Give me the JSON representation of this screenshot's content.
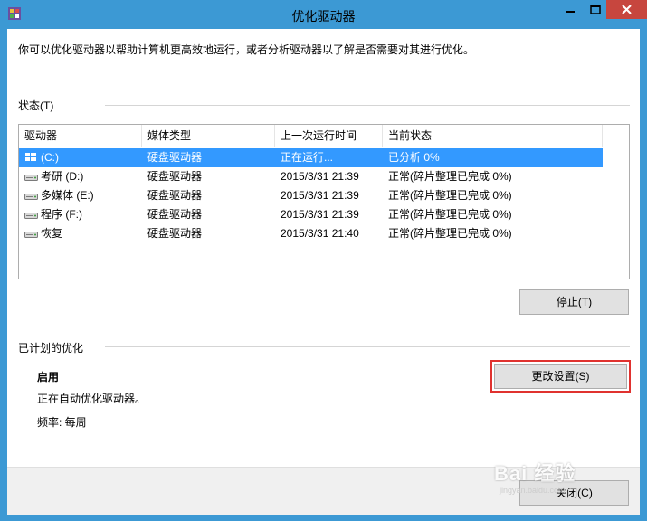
{
  "window": {
    "title": "优化驱动器",
    "accent_color": "#3c99d4",
    "close_color": "#c7463e"
  },
  "intro_text": "你可以优化驱动器以帮助计算机更高效地运行，或者分析驱动器以了解是否需要对其进行优化。",
  "status_section": {
    "label": "状态(T)"
  },
  "drive_table": {
    "columns": [
      "驱动器",
      "媒体类型",
      "上一次运行时间",
      "当前状态"
    ],
    "rows": [
      {
        "drive": "(C:)",
        "media": "硬盘驱动器",
        "last_run": "正在运行...",
        "status": "已分析 0%",
        "icon": "windows-drive-icon",
        "selected": true
      },
      {
        "drive": "考研 (D:)",
        "media": "硬盘驱动器",
        "last_run": "2015/3/31 21:39",
        "status": "正常(碎片整理已完成 0%)",
        "icon": "hard-drive-icon",
        "selected": false
      },
      {
        "drive": "多媒体 (E:)",
        "media": "硬盘驱动器",
        "last_run": "2015/3/31 21:39",
        "status": "正常(碎片整理已完成 0%)",
        "icon": "hard-drive-icon",
        "selected": false
      },
      {
        "drive": "程序 (F:)",
        "media": "硬盘驱动器",
        "last_run": "2015/3/31 21:39",
        "status": "正常(碎片整理已完成 0%)",
        "icon": "hard-drive-icon",
        "selected": false
      },
      {
        "drive": "恢复",
        "media": "硬盘驱动器",
        "last_run": "2015/3/31 21:40",
        "status": "正常(碎片整理已完成 0%)",
        "icon": "hard-drive-icon",
        "selected": false
      }
    ]
  },
  "buttons": {
    "stop": "停止(T)",
    "change_settings": "更改设置(S)",
    "close": "关闭(C)"
  },
  "scheduled": {
    "label": "已计划的优化",
    "state": "启用",
    "description": "正在自动优化驱动器。",
    "frequency": "频率: 每周"
  },
  "highlight_color": "#e0322f",
  "watermark": {
    "text": "Bai 经验",
    "sub": "jingyan.baidu.com"
  }
}
